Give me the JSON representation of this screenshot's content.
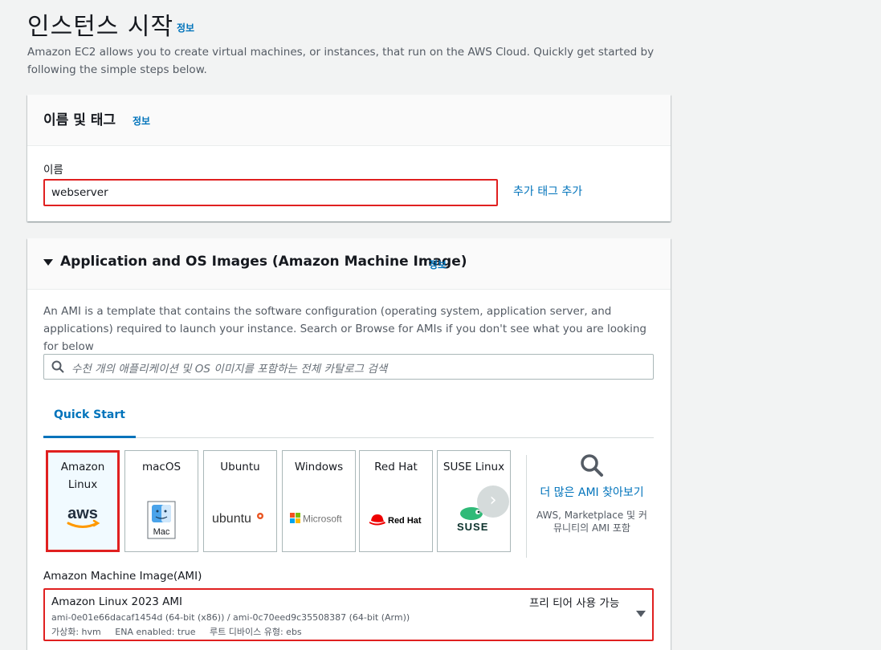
{
  "page": {
    "title": "인스턴스 시작",
    "info": "정보",
    "description": "Amazon EC2 allows you to create virtual machines, or instances, that run on the AWS Cloud. Quickly get started by following the simple steps below."
  },
  "name_tags": {
    "title": "이름 및 태그",
    "info": "정보",
    "name_label": "이름",
    "name_value": "webserver",
    "add_tags": "추가 태그 추가"
  },
  "ami": {
    "title": "Application and OS Images (Amazon Machine Image)",
    "info": "정보",
    "description": "An AMI is a template that contains the software configuration (operating system, application server, and applications) required to launch your instance. Search or Browse for AMIs if you don't see what you are looking for below",
    "search_placeholder": "수천 개의 애플리케이션 및 OS 이미지를 포함하는 전체 카탈로그 검색",
    "tab": "Quick Start",
    "os_options": [
      {
        "name": "Amazon Linux",
        "logo_text": "aws",
        "icon": "aws-logo",
        "selected": true
      },
      {
        "name": "macOS",
        "logo_text": "Mac",
        "icon": "mac-finder-icon",
        "selected": false
      },
      {
        "name": "Ubuntu",
        "logo_text": "ubuntu",
        "icon": "ubuntu-logo",
        "selected": false
      },
      {
        "name": "Windows",
        "logo_text": "Microsoft",
        "icon": "microsoft-logo",
        "selected": false
      },
      {
        "name": "Red Hat",
        "logo_text": "Red Hat",
        "icon": "redhat-logo",
        "selected": false
      },
      {
        "name": "SUSE Linux",
        "logo_text": "SUSE",
        "icon": "suse-logo",
        "selected": false
      }
    ],
    "more_ami_link": "더 많은 AMI 찾아보기",
    "more_ami_sub": "AWS, Marketplace 및 커뮤니티의 AMI 포함",
    "ami_label": "Amazon Machine Image(AMI)",
    "selected_ami": {
      "name": "Amazon Linux 2023 AMI",
      "free_tier": "프리 티어 사용 가능",
      "ids": "ami-0e01e66dacaf1454d (64-bit (x86)) / ami-0c70eed9c35508387 (64-bit (Arm))",
      "virtualization": "가상화: hvm",
      "ena": "ENA enabled: true",
      "root_device": "루트 디바이스 유형: ebs"
    }
  },
  "colors": {
    "link": "#0073bb",
    "highlight": "#e02020",
    "background": "#f2f3f3"
  }
}
